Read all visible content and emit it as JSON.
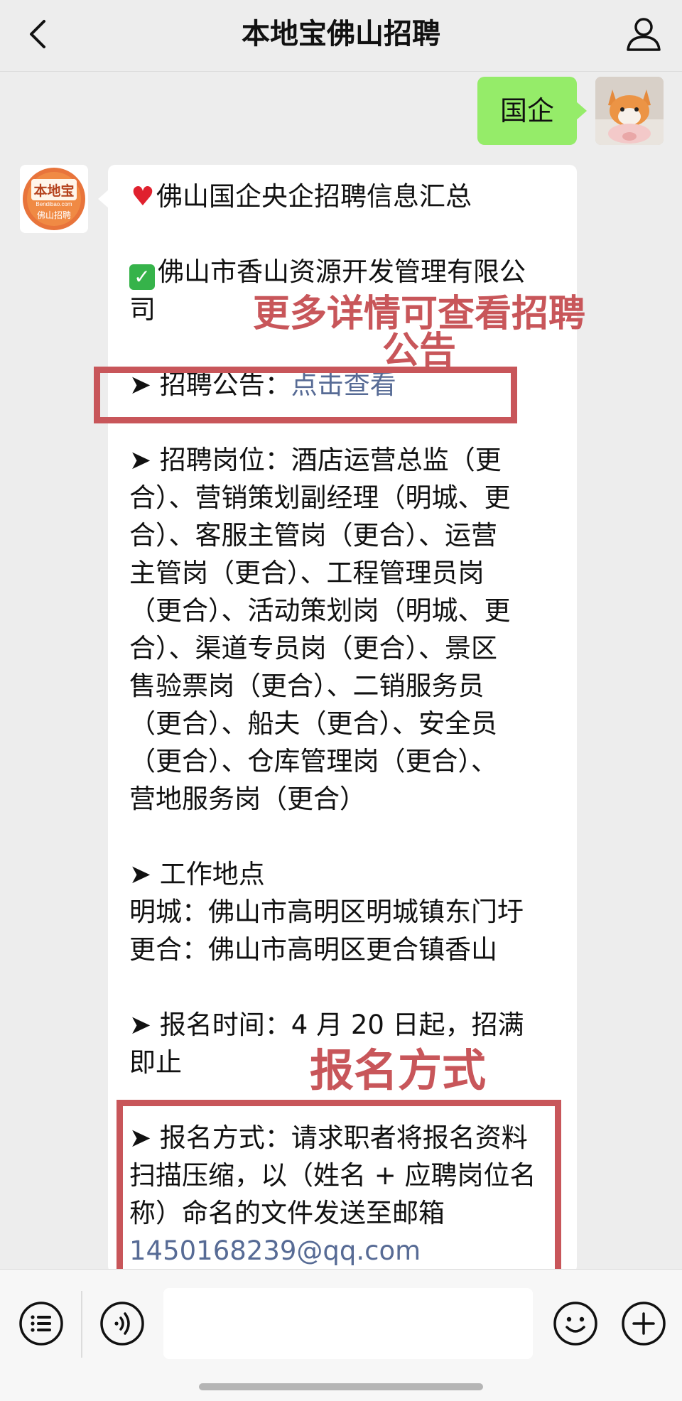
{
  "header": {
    "title": "本地宝佛山招聘"
  },
  "my_message": {
    "text": "国企"
  },
  "bot_avatar": {
    "logo_text": "本地宝",
    "logo_sub": "Bendibao.com",
    "logo_tag": "佛山招聘"
  },
  "message": {
    "headline": "佛山国企央企招聘信息汇总",
    "company_line1": "佛山市香山资源开发管理有限公",
    "company_line2": "司",
    "notice_label": "➤ 招聘公告：",
    "notice_link": "点击查看",
    "positions_lines": [
      "➤ 招聘岗位：酒店运营总监（更",
      "合）、营销策划副经理（明城、更",
      "合）、客服主管岗（更合）、运营",
      "主管岗（更合）、工程管理员岗",
      "（更合）、活动策划岗（明城、更",
      "合）、渠道专员岗（更合）、景区",
      "售验票岗（更合）、二销服务员",
      "（更合）、船夫（更合）、安全员",
      "（更合）、仓库管理岗（更合）、",
      "营地服务岗（更合）"
    ],
    "location_title": "➤ 工作地点",
    "location_lines": [
      "明城：佛山市高明区明城镇东门圩",
      "更合：佛山市高明区更合镇香山"
    ],
    "time_lines": [
      "➤ 报名时间：4 月 20 日起，招满",
      "即止"
    ],
    "method_lines": [
      "➤ 报名方式：请求职者将报名资料",
      "扫描压缩，以（姓名 + 应聘岗位名",
      "称）命名的文件发送至邮箱"
    ],
    "email": "1450168239@qq.com"
  },
  "annotations": {
    "notice_note_line1": "更多详情可查看招聘",
    "notice_note_line2": "公告",
    "method_note": "报名方式"
  },
  "colors": {
    "bubble_mine": "#95ec69",
    "link": "#576b95",
    "annotation": "#c8565a"
  }
}
